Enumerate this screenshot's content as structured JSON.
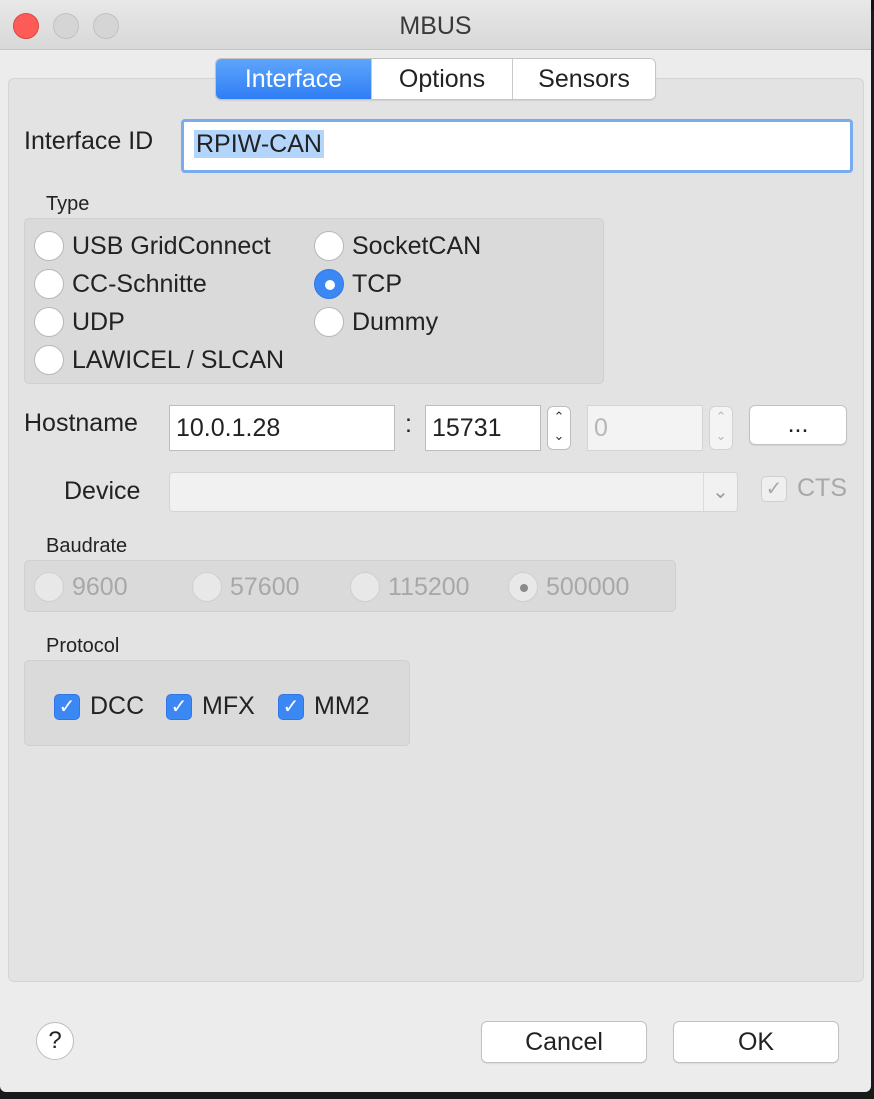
{
  "window": {
    "title": "MBUS"
  },
  "tabs": [
    "Interface",
    "Options",
    "Sensors"
  ],
  "interface_id": {
    "label": "Interface ID",
    "value": "RPIW-CAN"
  },
  "type": {
    "label": "Type",
    "options": [
      "USB GridConnect",
      "SocketCAN",
      "CC-Schnitte",
      "TCP",
      "UDP",
      "Dummy",
      "LAWICEL / SLCAN"
    ],
    "selected": "TCP"
  },
  "hostname": {
    "label": "Hostname",
    "value": "10.0.1.28",
    "separator": ":",
    "port": "15731",
    "secondary": "0",
    "browse_label": "..."
  },
  "device": {
    "label": "Device",
    "value": "",
    "cts_label": "CTS",
    "cts_checked": true,
    "enabled": false
  },
  "baudrate": {
    "label": "Baudrate",
    "options": [
      "9600",
      "57600",
      "115200",
      "500000"
    ],
    "selected": "500000",
    "enabled": false
  },
  "protocol": {
    "label": "Protocol",
    "options": [
      {
        "label": "DCC",
        "checked": true
      },
      {
        "label": "MFX",
        "checked": true
      },
      {
        "label": "MM2",
        "checked": true
      }
    ]
  },
  "footer": {
    "help_label": "?",
    "cancel_label": "Cancel",
    "ok_label": "OK"
  },
  "colors": {
    "accent": "#3b88f5",
    "close": "#fc5b57"
  }
}
